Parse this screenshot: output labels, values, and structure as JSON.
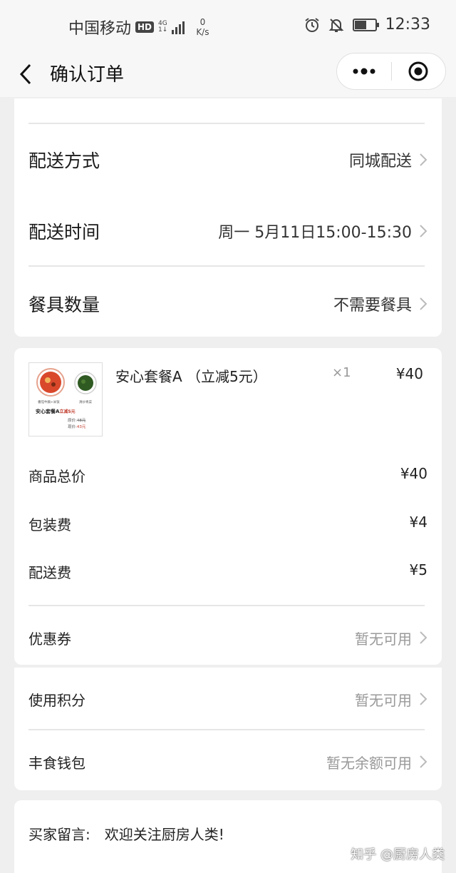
{
  "status_bar": {
    "carrier": "中国移动",
    "hd": "HD",
    "network": "4G",
    "network_sub": "1↓",
    "speed_value": "0",
    "speed_unit": "K/s",
    "time": "12:33",
    "battery_level": 0.55
  },
  "nav": {
    "title": "确认订单"
  },
  "delivery": {
    "method_label": "配送方式",
    "method_value": "同城配送",
    "time_label": "配送时间",
    "time_value": "周一 5月11日15:00-15:30",
    "utensils_label": "餐具数量",
    "utensils_value": "不需要餐具"
  },
  "product": {
    "name": "安心套餐A （立减5元）",
    "qty": "×1",
    "price": "¥40",
    "thumb": {
      "left_caption": "番茄牛腩+米饭",
      "right_caption": "清炒青菜",
      "title_main": "安心套餐A",
      "title_red": "立减5元",
      "orig_label": "原价:",
      "orig_price": "48元",
      "now_label": "现价:",
      "now_price": "43元"
    }
  },
  "prices": {
    "subtotal_label": "商品总价",
    "subtotal_value": "¥40",
    "packing_label": "包装费",
    "packing_value": "¥4",
    "delivery_fee_label": "配送费",
    "delivery_fee_value": "¥5",
    "coupon_label": "优惠券",
    "coupon_value": "暂无可用"
  },
  "extras": {
    "points_label": "使用积分",
    "points_value": "暂无可用",
    "wallet_label": "丰食钱包",
    "wallet_value": "暂无余额可用"
  },
  "message": {
    "label": "买家留言:",
    "text": "欢迎关注厨房人类!"
  },
  "watermark": "知乎 @厨房人类"
}
